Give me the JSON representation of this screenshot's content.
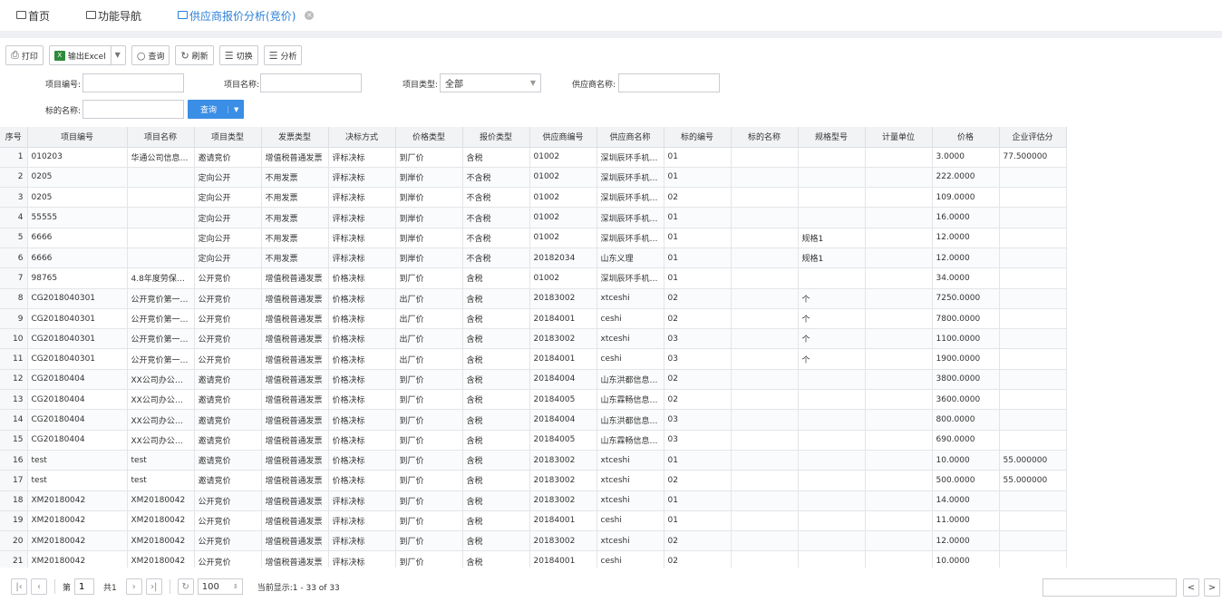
{
  "tabs": [
    {
      "label": "首页"
    },
    {
      "label": "功能导航"
    },
    {
      "label": "供应商报价分析(竞价)"
    }
  ],
  "toolbar": {
    "print": "打印",
    "excel": "输出Excel",
    "query": "查询",
    "refresh": "刷新",
    "switch": "切换",
    "analyze": "分析"
  },
  "form": {
    "project_no_label": "项目编号:",
    "project_name_label": "项目名称:",
    "project_type_label": "项目类型:",
    "project_type_value": "全部",
    "supplier_name_label": "供应商名称:",
    "target_name_label": "标的名称:",
    "query_button": "查询"
  },
  "grid": {
    "headers": [
      "序号",
      "项目编号",
      "项目名称",
      "项目类型",
      "发票类型",
      "决标方式",
      "价格类型",
      "报价类型",
      "供应商编号",
      "供应商名称",
      "标的编号",
      "标的名称",
      "规格型号",
      "计量单位",
      "价格",
      "企业评估分"
    ],
    "rows": [
      [
        "1",
        "010203",
        "华通公司信息…",
        "邀请竞价",
        "增值税普通发票",
        "评标决标",
        "到厂价",
        "含税",
        "01002",
        "深圳辰环手机…",
        "01",
        "",
        "",
        "",
        "3.0000",
        "77.500000"
      ],
      [
        "2",
        "0205",
        "",
        "定向公开",
        "不用发票",
        "评标决标",
        "到岸价",
        "不含税",
        "01002",
        "深圳辰环手机…",
        "01",
        "",
        "",
        "",
        "222.0000",
        ""
      ],
      [
        "3",
        "0205",
        "",
        "定向公开",
        "不用发票",
        "评标决标",
        "到岸价",
        "不含税",
        "01002",
        "深圳辰环手机…",
        "02",
        "",
        "",
        "",
        "109.0000",
        ""
      ],
      [
        "4",
        "55555",
        "",
        "定向公开",
        "不用发票",
        "评标决标",
        "到岸价",
        "不含税",
        "01002",
        "深圳辰环手机…",
        "01",
        "",
        "",
        "",
        "16.0000",
        ""
      ],
      [
        "5",
        "6666",
        "",
        "定向公开",
        "不用发票",
        "评标决标",
        "到岸价",
        "不含税",
        "01002",
        "深圳辰环手机…",
        "01",
        "",
        "规格1",
        "",
        "12.0000",
        ""
      ],
      [
        "6",
        "6666",
        "",
        "定向公开",
        "不用发票",
        "评标决标",
        "到岸价",
        "不含税",
        "20182034",
        "山东义理",
        "01",
        "",
        "规格1",
        "",
        "12.0000",
        ""
      ],
      [
        "7",
        "98765",
        "4.8年度劳保…",
        "公开竞价",
        "增值税普通发票",
        "价格决标",
        "到厂价",
        "含税",
        "01002",
        "深圳辰环手机…",
        "01",
        "",
        "",
        "",
        "34.0000",
        ""
      ],
      [
        "8",
        "CG2018040301",
        "公开竞价第一…",
        "公开竞价",
        "增值税普通发票",
        "价格决标",
        "出厂价",
        "含税",
        "20183002",
        "xtceshi",
        "02",
        "",
        "个",
        "",
        "7250.0000",
        ""
      ],
      [
        "9",
        "CG2018040301",
        "公开竞价第一…",
        "公开竞价",
        "增值税普通发票",
        "价格决标",
        "出厂价",
        "含税",
        "20184001",
        "ceshi",
        "02",
        "",
        "个",
        "",
        "7800.0000",
        ""
      ],
      [
        "10",
        "CG2018040301",
        "公开竞价第一…",
        "公开竞价",
        "增值税普通发票",
        "价格决标",
        "出厂价",
        "含税",
        "20183002",
        "xtceshi",
        "03",
        "",
        "个",
        "",
        "1100.0000",
        ""
      ],
      [
        "11",
        "CG2018040301",
        "公开竞价第一…",
        "公开竞价",
        "增值税普通发票",
        "价格决标",
        "出厂价",
        "含税",
        "20184001",
        "ceshi",
        "03",
        "",
        "个",
        "",
        "1900.0000",
        ""
      ],
      [
        "12",
        "CG20180404",
        "XX公司办公…",
        "邀请竞价",
        "增值税普通发票",
        "价格决标",
        "到厂价",
        "含税",
        "20184004",
        "山东洪都信息…",
        "02",
        "",
        "",
        "",
        "3800.0000",
        ""
      ],
      [
        "13",
        "CG20180404",
        "XX公司办公…",
        "邀请竞价",
        "增值税普通发票",
        "价格决标",
        "到厂价",
        "含税",
        "20184005",
        "山东霖畅信息…",
        "02",
        "",
        "",
        "",
        "3600.0000",
        ""
      ],
      [
        "14",
        "CG20180404",
        "XX公司办公…",
        "邀请竞价",
        "增值税普通发票",
        "价格决标",
        "到厂价",
        "含税",
        "20184004",
        "山东洪都信息…",
        "03",
        "",
        "",
        "",
        "800.0000",
        ""
      ],
      [
        "15",
        "CG20180404",
        "XX公司办公…",
        "邀请竞价",
        "增值税普通发票",
        "价格决标",
        "到厂价",
        "含税",
        "20184005",
        "山东霖畅信息…",
        "03",
        "",
        "",
        "",
        "690.0000",
        ""
      ],
      [
        "16",
        "test",
        "test",
        "邀请竞价",
        "增值税普通发票",
        "价格决标",
        "到厂价",
        "含税",
        "20183002",
        "xtceshi",
        "01",
        "",
        "",
        "",
        "10.0000",
        "55.000000"
      ],
      [
        "17",
        "test",
        "test",
        "邀请竞价",
        "增值税普通发票",
        "价格决标",
        "到厂价",
        "含税",
        "20183002",
        "xtceshi",
        "02",
        "",
        "",
        "",
        "500.0000",
        "55.000000"
      ],
      [
        "18",
        "XM20180042",
        "XM20180042",
        "公开竞价",
        "增值税普通发票",
        "评标决标",
        "到厂价",
        "含税",
        "20183002",
        "xtceshi",
        "01",
        "",
        "",
        "",
        "14.0000",
        ""
      ],
      [
        "19",
        "XM20180042",
        "XM20180042",
        "公开竞价",
        "增值税普通发票",
        "评标决标",
        "到厂价",
        "含税",
        "20184001",
        "ceshi",
        "01",
        "",
        "",
        "",
        "11.0000",
        ""
      ],
      [
        "20",
        "XM20180042",
        "XM20180042",
        "公开竞价",
        "增值税普通发票",
        "评标决标",
        "到厂价",
        "含税",
        "20183002",
        "xtceshi",
        "02",
        "",
        "",
        "",
        "12.0000",
        ""
      ],
      [
        "21",
        "XM20180042",
        "XM20180042",
        "公开竞价",
        "增值税普通发票",
        "评标决标",
        "到厂价",
        "含税",
        "20184001",
        "ceshi",
        "02",
        "",
        "",
        "",
        "10.0000",
        ""
      ]
    ]
  },
  "pager": {
    "page_prefix": "第",
    "page_value": "1",
    "page_total": "共1",
    "page_size": "100",
    "display_info": "当前显示:1 - 33 of 33"
  }
}
